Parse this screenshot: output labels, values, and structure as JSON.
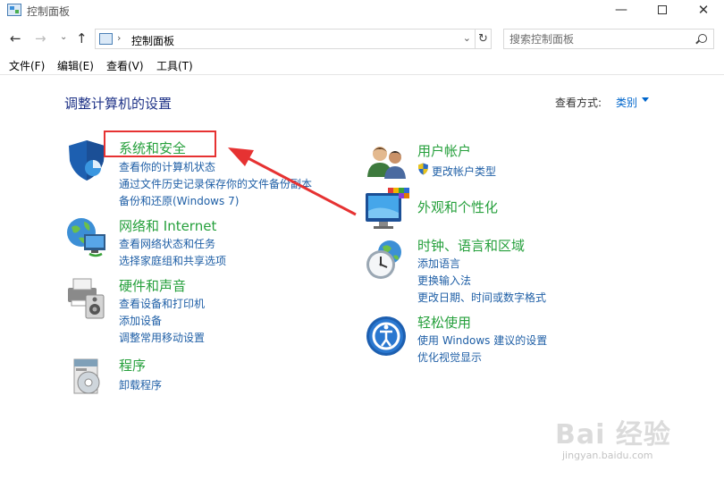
{
  "window": {
    "title": "控制面板",
    "minimize": "—",
    "close": "✕"
  },
  "nav": {
    "back": "←",
    "forward": "→",
    "recent": "⌄",
    "up": "↑",
    "address_sep": "›",
    "address": "控制面板",
    "address_drop": "⌄",
    "refresh": "↻",
    "search_placeholder": "搜索控制面板"
  },
  "menu": [
    "文件(F)",
    "编辑(E)",
    "查看(V)",
    "工具(T)"
  ],
  "content": {
    "title": "调整计算机的设置",
    "view_label": "查看方式:",
    "view_value": "类别"
  },
  "categories": [
    {
      "title": "系统和安全",
      "icon": "shield-icon",
      "links": [
        "查看你的计算机状态",
        "通过文件历史记录保存你的文件备份副本",
        "备份和还原(Windows 7)"
      ]
    },
    {
      "title": "网络和 Internet",
      "icon": "network-globe-icon",
      "links": [
        "查看网络状态和任务",
        "选择家庭组和共享选项"
      ]
    },
    {
      "title": "硬件和声音",
      "icon": "printer-speaker-icon",
      "links": [
        "查看设备和打印机",
        "添加设备",
        "调整常用移动设置"
      ]
    },
    {
      "title": "程序",
      "icon": "programs-disc-icon",
      "links": [
        "卸载程序"
      ]
    },
    {
      "title": "用户帐户",
      "icon": "users-icon",
      "links": [
        "更改帐户类型"
      ]
    },
    {
      "title": "外观和个性化",
      "icon": "monitor-palette-icon",
      "links": []
    },
    {
      "title": "时钟、语言和区域",
      "icon": "clock-globe-icon",
      "links": [
        "添加语言",
        "更换输入法",
        "更改日期、时间或数字格式"
      ]
    },
    {
      "title": "轻松使用",
      "icon": "ease-of-access-icon",
      "links": [
        "使用 Windows 建议的设置",
        "优化视觉显示"
      ]
    }
  ],
  "watermark": {
    "text": "Bai 经验",
    "sub": "jingyan.baidu.com"
  },
  "colors": {
    "title_blue": "#1e3287",
    "category_green": "#26a03c",
    "link_blue": "#1f5fa6",
    "highlight_red": "#e63232"
  }
}
